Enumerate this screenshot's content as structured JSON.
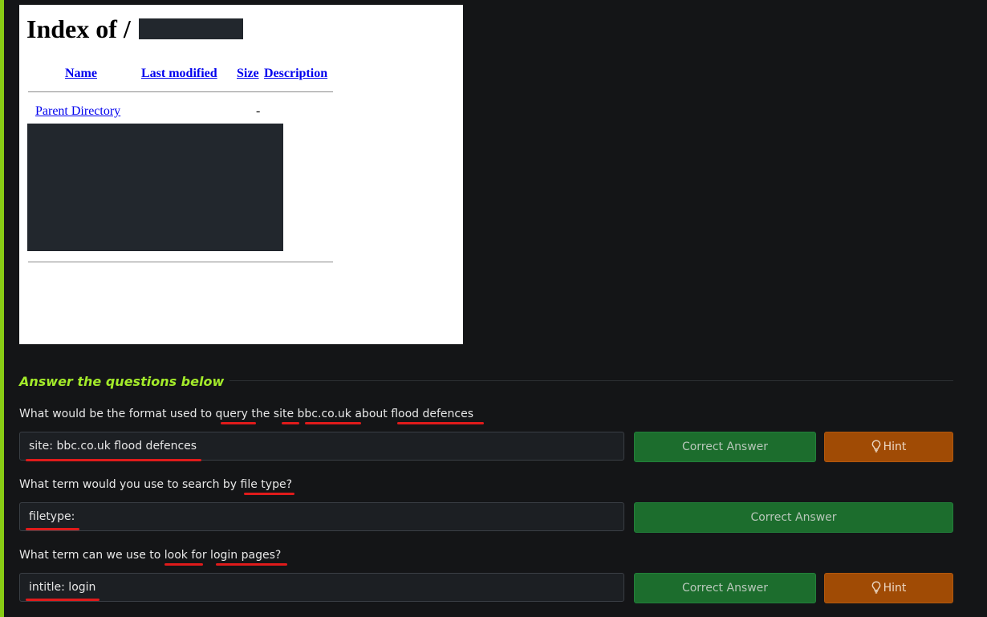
{
  "directory_listing": {
    "title": "Index of /",
    "columns": [
      "Name",
      "Last modified",
      "Size",
      "Description"
    ],
    "parent_link": "Parent Directory",
    "parent_size": "-"
  },
  "section": {
    "heading": "Answer the questions below"
  },
  "questions": [
    {
      "text": "What would be the format used to query the site bbc.co.uk about flood defences",
      "answer": "site: bbc.co.uk flood defences",
      "correct_label": "Correct Answer",
      "hint_label": "Hint"
    },
    {
      "text": "What term would you use to search by file type?",
      "answer": "filetype:",
      "correct_label": "Correct Answer"
    },
    {
      "text": "What term can we use to look for login pages?",
      "answer": "intitle: login",
      "correct_label": "Correct Answer",
      "hint_label": "Hint"
    }
  ],
  "colors": {
    "accent_green": "#a3ea2a",
    "correct_green": "#1c6d2d",
    "hint_orange": "#a04b05",
    "annotation_red": "#e01b1b",
    "redaction": "#22272d"
  },
  "icons": {
    "hint": "lightbulb-icon"
  }
}
